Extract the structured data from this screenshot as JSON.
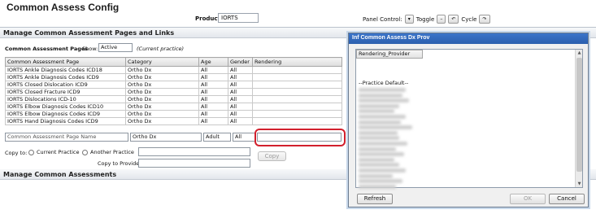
{
  "page": {
    "title": "Common Assess Config"
  },
  "product": {
    "label": "Product",
    "value": "IORTS"
  },
  "panel_control": {
    "label": "Panel Control:",
    "toggle": "Toggle",
    "cycle": "Cycle"
  },
  "manage_pages": {
    "header": "Manage Common Assessment Pages and Links",
    "caption": "Common Assessment Pages",
    "show_label": "Show:",
    "show_value": "Active",
    "current_note": "(Current practice)",
    "columns": [
      "Common Assessment Page",
      "Category",
      "Age",
      "Gender",
      "Rendering"
    ],
    "rows": [
      [
        "IORTS Ankle Diagnosis Codes ICD18",
        "Ortho Dx",
        "All",
        "All",
        ""
      ],
      [
        "IORTS Ankle Diagnosis Codes ICD9",
        "Ortho Dx",
        "All",
        "All",
        ""
      ],
      [
        "IORTS Closed Dislocation ICD9",
        "Ortho Dx",
        "All",
        "All",
        ""
      ],
      [
        "IORTS Closed Fracture ICD9",
        "Ortho Dx",
        "All",
        "All",
        ""
      ],
      [
        "IORTS Dislocations ICD-10",
        "Ortho Dx",
        "All",
        "All",
        ""
      ],
      [
        "IORTS Elbow Diagnosis Codes ICD10",
        "Ortho Dx",
        "All",
        "All",
        ""
      ],
      [
        "IORTS Elbow Diagnosis Codes ICD9",
        "Ortho Dx",
        "All",
        "All",
        ""
      ],
      [
        "IORTS Hand Diagnosis Codes ICD9",
        "Ortho Dx",
        "All",
        "All",
        ""
      ]
    ],
    "new_row": {
      "name_placeholder": "Common Assessment Page Name",
      "category": "Ortho Dx",
      "age": "Adult",
      "gender": "All",
      "rendering": ""
    },
    "copy_to_label": "Copy to:",
    "current_practice": "Current Practice",
    "another_practice": "Another Practice",
    "copy_to_provider_label": "Copy to Provider:",
    "copy_button": "Copy"
  },
  "manage_assessments": {
    "header": "Manage Common Assessments"
  },
  "dialog": {
    "title": "Inf Common Assess Dx Prov",
    "column_header": "Rendering_Provider",
    "first_item": "--Practice Default--",
    "refresh_button": "Refresh",
    "ok_button": "OK",
    "cancel_button": "Cancel"
  },
  "colors": {
    "highlight": "#d2202d",
    "dialog_title": "#2b5fae"
  }
}
